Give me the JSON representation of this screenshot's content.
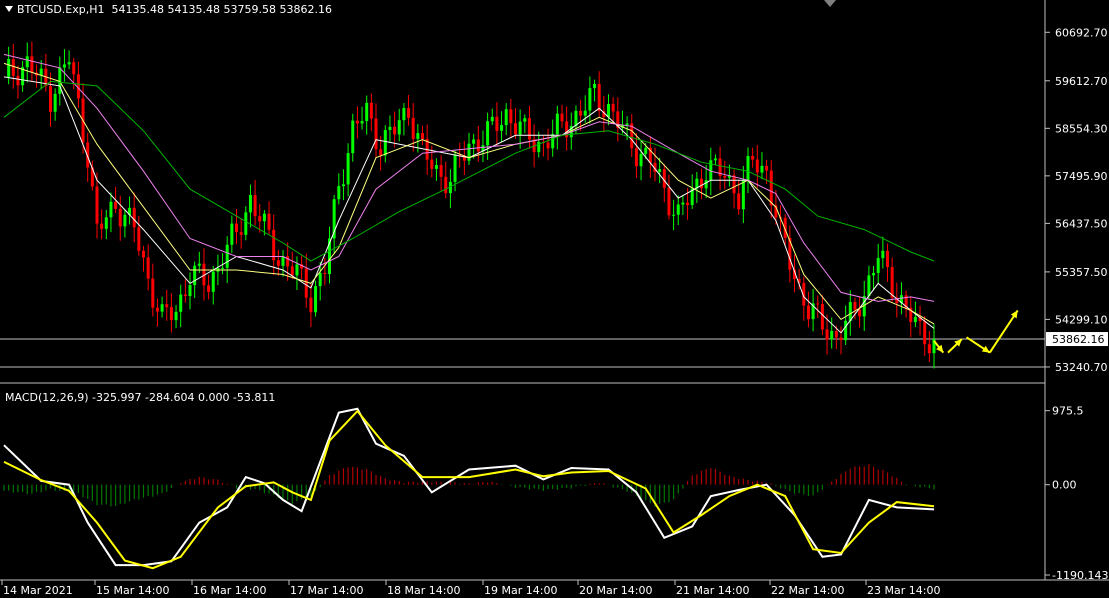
{
  "header": {
    "symbol": "BTCUSD.Exp,H1",
    "ohlc": "54135.48 54135.48 53759.58 53862.16"
  },
  "macd_header": {
    "label": "MACD(12,26,9) -325.997 -284.604 0.000 -53.811"
  },
  "colors": {
    "background": "#000000",
    "bull": "#00ff00",
    "bear": "#ff0000",
    "ma_fast": "#ffffff",
    "ma_mid": "#ffff80",
    "ma_slow": "#ee82ee",
    "ma_long": "#00b400",
    "signal": "#ffff00",
    "hist_pos": "#b00000",
    "hist_neg": "#007800",
    "arrow": "#ffff00",
    "grid": "#c0c0c0"
  },
  "chart_data": [
    {
      "type": "candlestick",
      "title": "BTCUSD.Exp,H1",
      "y_ticks": [
        "60692.70",
        "59612.70",
        "58554.30",
        "57495.90",
        "56437.50",
        "55357.50",
        "54299.10",
        "53240.70"
      ],
      "ylim": [
        52950,
        61100
      ],
      "current_price": "53862.16",
      "horizontal_lines": [
        53862.16,
        53240.7
      ],
      "x_ticks": [
        "14 Mar 2021",
        "15 Mar 14:00",
        "16 Mar 14:00",
        "17 Mar 14:00",
        "18 Mar 14:00",
        "19 Mar 14:00",
        "20 Mar 14:00",
        "21 Mar 14:00",
        "22 Mar 14:00",
        "23 Mar 14:00"
      ],
      "close_path": [
        [
          0,
          59700
        ],
        [
          5,
          60000
        ],
        [
          10,
          59300
        ],
        [
          14,
          60100
        ],
        [
          18,
          58000
        ],
        [
          20,
          56200
        ],
        [
          24,
          56900
        ],
        [
          28,
          56300
        ],
        [
          31,
          55200
        ],
        [
          34,
          54300
        ],
        [
          37,
          54500
        ],
        [
          40,
          55300
        ],
        [
          44,
          55100
        ],
        [
          47,
          55700
        ],
        [
          50,
          56200
        ],
        [
          53,
          57000
        ],
        [
          56,
          56300
        ],
        [
          59,
          55700
        ],
        [
          63,
          55300
        ],
        [
          66,
          54800
        ],
        [
          69,
          55400
        ],
        [
          72,
          57300
        ],
        [
          75,
          58500
        ],
        [
          78,
          58900
        ],
        [
          81,
          58200
        ],
        [
          84,
          58500
        ],
        [
          87,
          59000
        ],
        [
          90,
          58000
        ],
        [
          93,
          57600
        ],
        [
          96,
          57400
        ],
        [
          100,
          58200
        ],
        [
          104,
          58400
        ],
        [
          108,
          58900
        ],
        [
          112,
          58400
        ],
        [
          116,
          58200
        ],
        [
          120,
          58600
        ],
        [
          124,
          58900
        ],
        [
          127,
          59300
        ],
        [
          130,
          59000
        ],
        [
          133,
          58500
        ],
        [
          136,
          58100
        ],
        [
          139,
          57800
        ],
        [
          142,
          57200
        ],
        [
          145,
          56600
        ],
        [
          148,
          57100
        ],
        [
          151,
          57700
        ],
        [
          155,
          57500
        ],
        [
          158,
          57100
        ],
        [
          161,
          57800
        ],
        [
          164,
          57600
        ],
        [
          167,
          56200
        ],
        [
          170,
          55300
        ],
        [
          173,
          54500
        ],
        [
          176,
          54200
        ],
        [
          179,
          53900
        ],
        [
          182,
          54300
        ],
        [
          185,
          54900
        ],
        [
          188,
          55700
        ],
        [
          191,
          55100
        ],
        [
          194,
          54500
        ],
        [
          197,
          54000
        ],
        [
          200,
          53862
        ]
      ],
      "moving_averages": [
        {
          "color_key": "ma_fast",
          "points": [
            [
              0,
              59700
            ],
            [
              12,
              59500
            ],
            [
              20,
              57400
            ],
            [
              30,
              56300
            ],
            [
              40,
              55100
            ],
            [
              50,
              55700
            ],
            [
              60,
              55400
            ],
            [
              66,
              55000
            ],
            [
              72,
              56500
            ],
            [
              80,
              58300
            ],
            [
              90,
              58100
            ],
            [
              100,
              57900
            ],
            [
              110,
              58400
            ],
            [
              120,
              58400
            ],
            [
              128,
              59000
            ],
            [
              135,
              58300
            ],
            [
              145,
              57000
            ],
            [
              152,
              57400
            ],
            [
              160,
              57400
            ],
            [
              166,
              56500
            ],
            [
              172,
              54800
            ],
            [
              180,
              54000
            ],
            [
              188,
              55100
            ],
            [
              195,
              54500
            ],
            [
              200,
              54100
            ]
          ]
        },
        {
          "color_key": "ma_mid",
          "points": [
            [
              0,
              60000
            ],
            [
              12,
              59600
            ],
            [
              20,
              58200
            ],
            [
              30,
              56800
            ],
            [
              40,
              55400
            ],
            [
              50,
              55400
            ],
            [
              60,
              55300
            ],
            [
              66,
              55100
            ],
            [
              72,
              55900
            ],
            [
              80,
              57900
            ],
            [
              90,
              58300
            ],
            [
              100,
              57900
            ],
            [
              110,
              58200
            ],
            [
              120,
              58400
            ],
            [
              128,
              58800
            ],
            [
              135,
              58500
            ],
            [
              145,
              57400
            ],
            [
              152,
              57000
            ],
            [
              160,
              57400
            ],
            [
              166,
              56800
            ],
            [
              172,
              55300
            ],
            [
              180,
              54300
            ],
            [
              188,
              54800
            ],
            [
              195,
              54500
            ],
            [
              200,
              54200
            ]
          ]
        },
        {
          "color_key": "ma_slow",
          "points": [
            [
              0,
              60200
            ],
            [
              12,
              59900
            ],
            [
              20,
              59000
            ],
            [
              30,
              57600
            ],
            [
              40,
              56100
            ],
            [
              50,
              55700
            ],
            [
              60,
              55700
            ],
            [
              66,
              55400
            ],
            [
              72,
              55700
            ],
            [
              80,
              57200
            ],
            [
              90,
              58000
            ],
            [
              100,
              58100
            ],
            [
              110,
              58200
            ],
            [
              120,
              58400
            ],
            [
              128,
              58700
            ],
            [
              135,
              58600
            ],
            [
              145,
              58000
            ],
            [
              152,
              57600
            ],
            [
              160,
              57400
            ],
            [
              166,
              57100
            ],
            [
              172,
              56000
            ],
            [
              180,
              54900
            ],
            [
              188,
              54700
            ],
            [
              195,
              54800
            ],
            [
              200,
              54700
            ]
          ]
        },
        {
          "color_key": "ma_long",
          "points": [
            [
              0,
              58800
            ],
            [
              10,
              59600
            ],
            [
              20,
              59500
            ],
            [
              30,
              58500
            ],
            [
              40,
              57200
            ],
            [
              50,
              56600
            ],
            [
              60,
              56000
            ],
            [
              66,
              55600
            ],
            [
              75,
              56100
            ],
            [
              85,
              56700
            ],
            [
              95,
              57200
            ],
            [
              110,
              58000
            ],
            [
              120,
              58400
            ],
            [
              130,
              58500
            ],
            [
              140,
              58200
            ],
            [
              150,
              57800
            ],
            [
              160,
              57600
            ],
            [
              168,
              57200
            ],
            [
              175,
              56600
            ],
            [
              185,
              56300
            ],
            [
              195,
              55800
            ],
            [
              200,
              55600
            ]
          ]
        }
      ],
      "forecast_arrows": [
        {
          "from": [
            200,
            53820
          ],
          "to": [
            202,
            53560
          ]
        },
        {
          "from": [
            203,
            53560
          ],
          "to": [
            206,
            53860
          ]
        },
        {
          "from": [
            207,
            53900
          ],
          "to": [
            212,
            53560
          ]
        },
        {
          "from": [
            212,
            53560
          ],
          "to": [
            218,
            54500
          ]
        }
      ]
    },
    {
      "type": "macd",
      "title": "MACD(12,26,9)",
      "y_ticks": [
        "975.5",
        "0.00",
        "-1190.143"
      ],
      "ylim": [
        -1190.143,
        1050
      ],
      "macd_line": [
        [
          0,
          520
        ],
        [
          8,
          50
        ],
        [
          14,
          0
        ],
        [
          18,
          -500
        ],
        [
          24,
          -1060
        ],
        [
          30,
          -1060
        ],
        [
          36,
          -1010
        ],
        [
          42,
          -500
        ],
        [
          48,
          -300
        ],
        [
          52,
          100
        ],
        [
          56,
          20
        ],
        [
          60,
          -200
        ],
        [
          64,
          -350
        ],
        [
          68,
          300
        ],
        [
          72,
          950
        ],
        [
          76,
          1000
        ],
        [
          80,
          540
        ],
        [
          86,
          380
        ],
        [
          92,
          -100
        ],
        [
          100,
          200
        ],
        [
          110,
          250
        ],
        [
          116,
          70
        ],
        [
          122,
          220
        ],
        [
          130,
          200
        ],
        [
          136,
          -100
        ],
        [
          142,
          -700
        ],
        [
          148,
          -550
        ],
        [
          152,
          -150
        ],
        [
          158,
          -70
        ],
        [
          164,
          0
        ],
        [
          170,
          -400
        ],
        [
          176,
          -950
        ],
        [
          180,
          -920
        ],
        [
          186,
          -200
        ],
        [
          192,
          -300
        ],
        [
          200,
          -326
        ]
      ],
      "signal_line": [
        [
          0,
          300
        ],
        [
          8,
          60
        ],
        [
          14,
          -80
        ],
        [
          20,
          -500
        ],
        [
          26,
          -1000
        ],
        [
          32,
          -1100
        ],
        [
          38,
          -950
        ],
        [
          46,
          -300
        ],
        [
          52,
          -20
        ],
        [
          58,
          30
        ],
        [
          62,
          -100
        ],
        [
          66,
          -200
        ],
        [
          70,
          580
        ],
        [
          76,
          970
        ],
        [
          82,
          520
        ],
        [
          90,
          100
        ],
        [
          100,
          100
        ],
        [
          110,
          200
        ],
        [
          116,
          110
        ],
        [
          122,
          160
        ],
        [
          130,
          180
        ],
        [
          138,
          -50
        ],
        [
          144,
          -630
        ],
        [
          150,
          -400
        ],
        [
          156,
          -150
        ],
        [
          162,
          0
        ],
        [
          168,
          -150
        ],
        [
          174,
          -850
        ],
        [
          180,
          -900
        ],
        [
          186,
          -500
        ],
        [
          192,
          -230
        ],
        [
          200,
          -285
        ]
      ],
      "histogram": [
        [
          0,
          -80
        ],
        [
          6,
          -120
        ],
        [
          10,
          -60
        ],
        [
          16,
          -120
        ],
        [
          20,
          -260
        ],
        [
          24,
          -280
        ],
        [
          28,
          -200
        ],
        [
          34,
          -120
        ],
        [
          38,
          30
        ],
        [
          42,
          100
        ],
        [
          46,
          60
        ],
        [
          50,
          -40
        ],
        [
          54,
          -60
        ],
        [
          58,
          -140
        ],
        [
          62,
          -240
        ],
        [
          66,
          -160
        ],
        [
          70,
          120
        ],
        [
          74,
          240
        ],
        [
          78,
          200
        ],
        [
          82,
          80
        ],
        [
          86,
          30
        ],
        [
          90,
          40
        ],
        [
          96,
          30
        ],
        [
          100,
          10
        ],
        [
          104,
          40
        ],
        [
          110,
          -30
        ],
        [
          116,
          -70
        ],
        [
          122,
          -40
        ],
        [
          128,
          30
        ],
        [
          134,
          -80
        ],
        [
          140,
          -280
        ],
        [
          144,
          -200
        ],
        [
          148,
          120
        ],
        [
          152,
          230
        ],
        [
          156,
          110
        ],
        [
          160,
          60
        ],
        [
          164,
          30
        ],
        [
          170,
          -110
        ],
        [
          174,
          -150
        ],
        [
          178,
          40
        ],
        [
          182,
          220
        ],
        [
          186,
          260
        ],
        [
          190,
          160
        ],
        [
          194,
          0
        ],
        [
          200,
          -54
        ]
      ]
    }
  ]
}
